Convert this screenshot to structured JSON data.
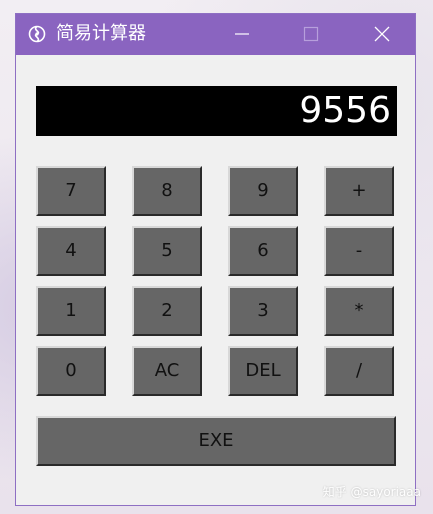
{
  "window": {
    "title": "简易计算器",
    "icon": "calculator-app-icon",
    "controls": {
      "minimize_icon": "minimize-icon",
      "maximize_icon": "maximize-icon",
      "close_icon": "close-icon"
    }
  },
  "display": {
    "value": "9556"
  },
  "keypad": {
    "keys": [
      "7",
      "8",
      "9",
      "+",
      "4",
      "5",
      "6",
      "-",
      "1",
      "2",
      "3",
      "*",
      "0",
      "AC",
      "DEL",
      "/"
    ],
    "exe_label": "EXE"
  },
  "watermark": "知乎 @sayoriaaa",
  "colors": {
    "titlebar": "#8a64c0",
    "display_bg": "#000000",
    "display_text": "#ffffff",
    "key_bg": "#666666",
    "window_bg": "#f0f0f0"
  }
}
